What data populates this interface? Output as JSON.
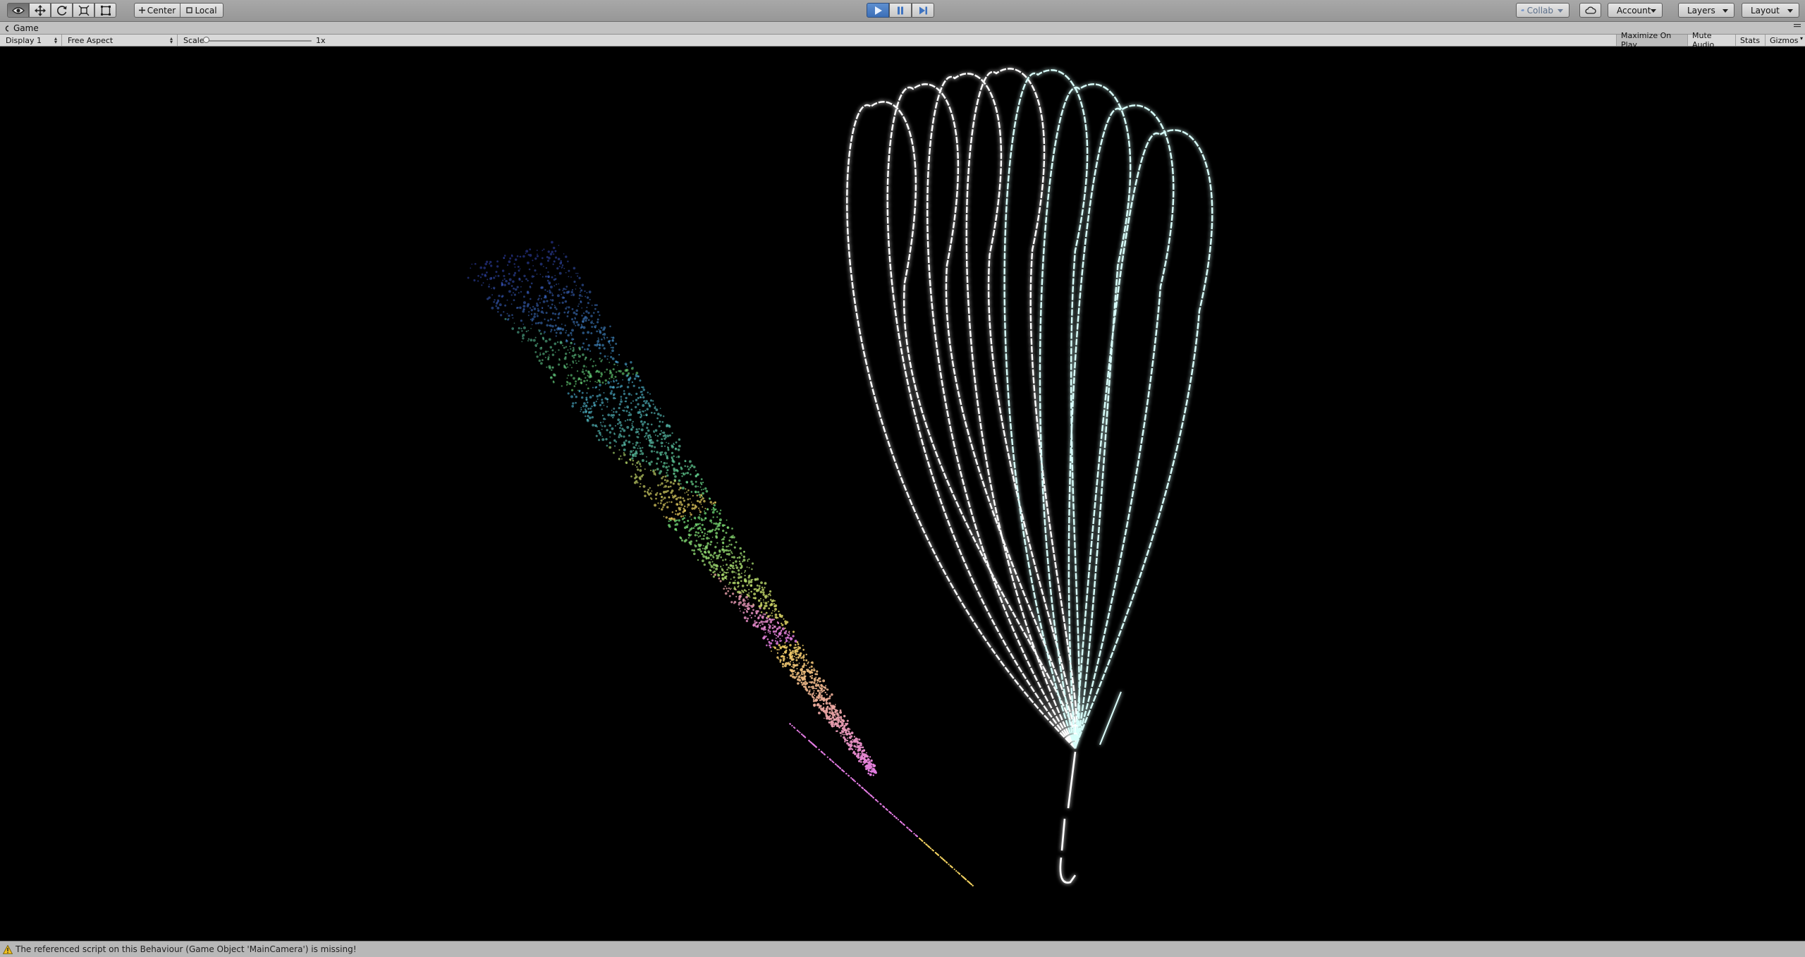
{
  "toolbar": {
    "tools": [
      {
        "name": "view-tool",
        "icon": "eye-icon"
      },
      {
        "name": "move-tool",
        "icon": "move-arrows-icon"
      },
      {
        "name": "rotate-tool",
        "icon": "rotate-icon"
      },
      {
        "name": "scale-tool",
        "icon": "scale-icon"
      },
      {
        "name": "rect-tool",
        "icon": "rect-icon"
      }
    ],
    "pivot_label": "Center",
    "space_label": "Local",
    "collab_label": "Collab",
    "account_label": "Account",
    "layers_label": "Layers",
    "layout_label": "Layout"
  },
  "playback": {
    "playing": true,
    "accent": "#3e73c0"
  },
  "tab": {
    "title": "Game"
  },
  "gamebar": {
    "display": "Display 1",
    "aspect": "Free Aspect",
    "scale_label": "Scale",
    "scale_value": "1x",
    "maximize_on_play": "Maximize On Play",
    "mute_audio": "Mute Audio",
    "stats": "Stats",
    "gizmos": "Gizmos"
  },
  "status": {
    "message": "The referenced script on this Behaviour (Game Object 'MainCamera') is missing!",
    "icon": "warning-triangle-icon"
  },
  "colors": {
    "toolbar": "#9e9e9e",
    "particles_trail": "#d8fffb",
    "particles_fan": [
      "#3c4fd8",
      "#4fb8e0",
      "#6fe07a",
      "#f0d060",
      "#e07ae0"
    ]
  }
}
